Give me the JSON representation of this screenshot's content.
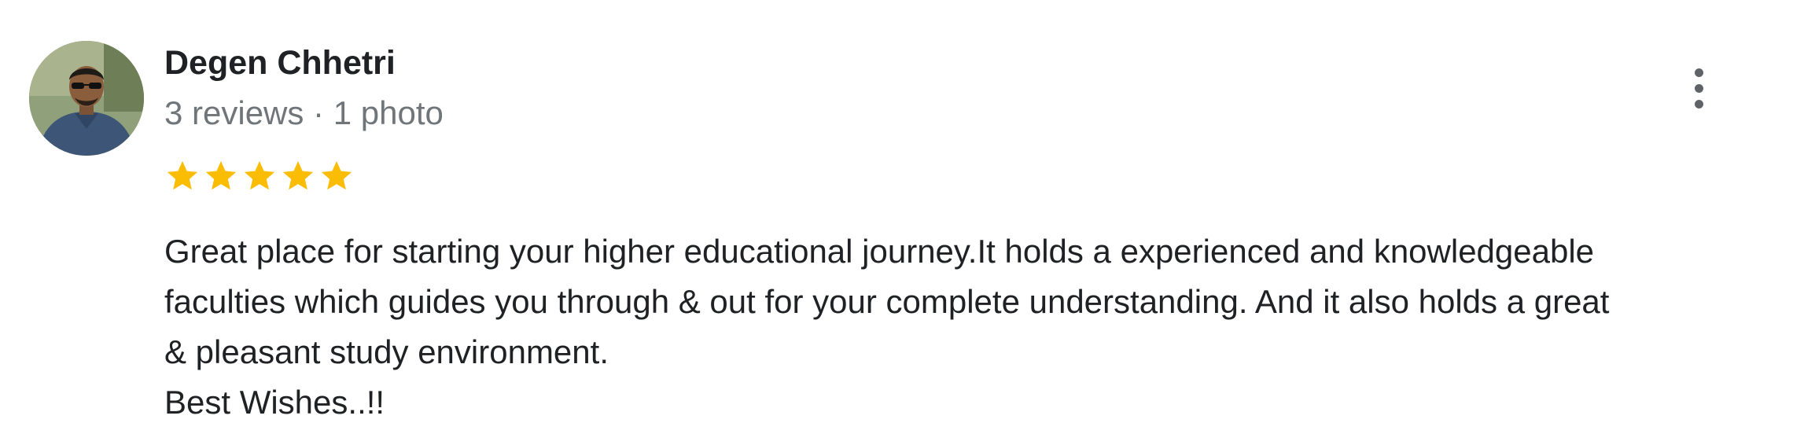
{
  "reviewer": {
    "name": "Degen Chhetri",
    "meta": "3 reviews · 1 photo"
  },
  "rating": {
    "stars": 5,
    "max": 5,
    "color": "#fbbc04"
  },
  "review": {
    "lines": [
      "Great place for starting your higher educational journey.It holds a experienced and knowledgeable",
      "faculties which guides you through & out for your complete understanding. And it also holds a great",
      "& pleasant study environment.",
      "Best Wishes..!!"
    ]
  },
  "icons": {
    "avatar": "reviewer-photo",
    "more": "more-vert-icon",
    "star": "star-icon"
  }
}
